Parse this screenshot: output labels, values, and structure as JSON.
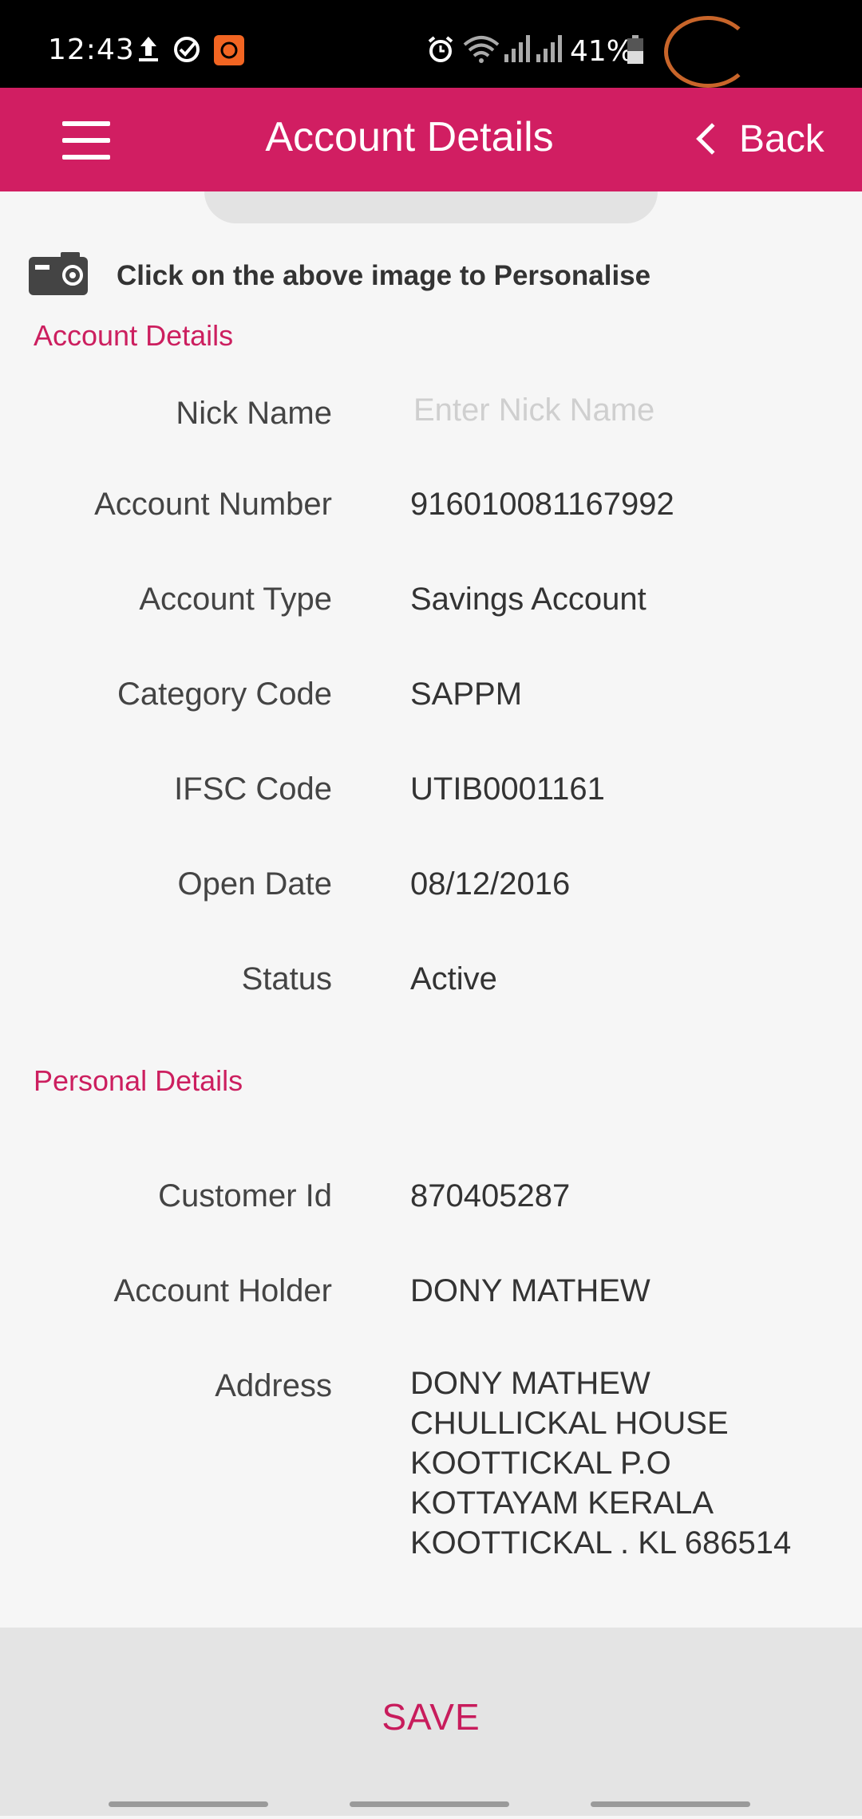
{
  "status_bar": {
    "time": "12:43",
    "battery": "41%",
    "icons": [
      "upload-icon",
      "check-circle-icon",
      "app-badge-icon",
      "alarm-icon",
      "wifi-icon",
      "signal-icon",
      "signal-icon",
      "battery-icon"
    ]
  },
  "header": {
    "title": "Account Details",
    "back_label": "Back",
    "menu_icon": "hamburger-menu-icon"
  },
  "personalise_hint": "Click on the above image to Personalise",
  "account_section": {
    "title": "Account Details",
    "nick_name_label": "Nick Name",
    "nick_name_placeholder": "Enter Nick Name",
    "nick_name_value": "",
    "rows": [
      {
        "label": "Account Number",
        "value": "916010081167992"
      },
      {
        "label": "Account Type",
        "value": "Savings Account"
      },
      {
        "label": "Category Code",
        "value": "SAPPM"
      },
      {
        "label": "IFSC Code",
        "value": "UTIB0001161"
      },
      {
        "label": "Open Date",
        "value": "08/12/2016"
      },
      {
        "label": "Status",
        "value": "Active"
      }
    ]
  },
  "personal_section": {
    "title": "Personal Details",
    "rows": [
      {
        "label": "Customer Id",
        "value": "870405287"
      },
      {
        "label": "Account Holder",
        "value": "DONY MATHEW"
      }
    ],
    "address_label": "Address",
    "address_lines": [
      "DONY MATHEW",
      "CHULLICKAL HOUSE",
      "KOOTTICKAL P.O",
      "KOTTAYAM KERALA",
      "KOOTTICKAL . KL 686514"
    ]
  },
  "save_label": "SAVE",
  "colors": {
    "brand": "#d11e62",
    "section_title": "#cc1f5f",
    "status_bar": "#000000",
    "save_bar": "#e4e4e4"
  }
}
